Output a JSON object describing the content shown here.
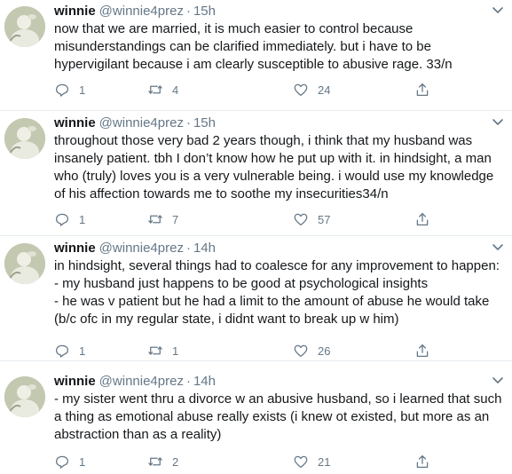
{
  "tweets": [
    {
      "name": "winnie",
      "handle": "@winnie4prez",
      "dot": "·",
      "time": "15h",
      "lines": [
        "now that we are married, it is much easier to control because",
        "misunderstandings can be clarified immediately. but i have to be",
        "hypervigilant because i am clearly susceptible to abusive rage. 33/n"
      ],
      "replies": "1",
      "retweets": "4",
      "likes": "24"
    },
    {
      "name": "winnie",
      "handle": "@winnie4prez",
      "dot": "·",
      "time": "15h",
      "lines": [
        "throughout those very bad 2 years though, i think that my husband was",
        "insanely patient. tbh I don’t know how he put up with it. in hindsight, a man",
        "who (truly) loves you is a very vulnerable being. i would use my knowledge",
        "of his affection towards me to soothe my insecurities34/n"
      ],
      "replies": "1",
      "retweets": "7",
      "likes": "57"
    },
    {
      "name": "winnie",
      "handle": "@winnie4prez",
      "dot": "·",
      "time": "14h",
      "lines": [
        "in hindsight, several things had to coalesce for any improvement to happen:",
        "- my husband just happens to be good at psychological insights",
        "- he was v patient but he had a limit to the amount of abuse he would take",
        "(b/c ofc in my regular state, i didnt want to break up w him)"
      ],
      "replies": "1",
      "retweets": "1",
      "likes": "26"
    },
    {
      "name": "winnie",
      "handle": "@winnie4prez",
      "dot": "·",
      "time": "14h",
      "lines": [
        "- my sister went thru a divorce w an abusive husband, so i learned that such",
        "a thing as emotional abuse really exists (i knew ot existed, but more as an",
        "abstraction than as a reality)"
      ],
      "replies": "1",
      "retweets": "2",
      "likes": "21"
    }
  ],
  "icons": {
    "avatar": "avatar-photo",
    "caret": "chevron-down-icon",
    "reply": "reply-icon",
    "retweet": "retweet-icon",
    "like": "heart-icon",
    "share": "share-icon"
  },
  "colors": {
    "text": "#14171a",
    "secondary": "#657786",
    "divider": "#e6ecf0"
  }
}
